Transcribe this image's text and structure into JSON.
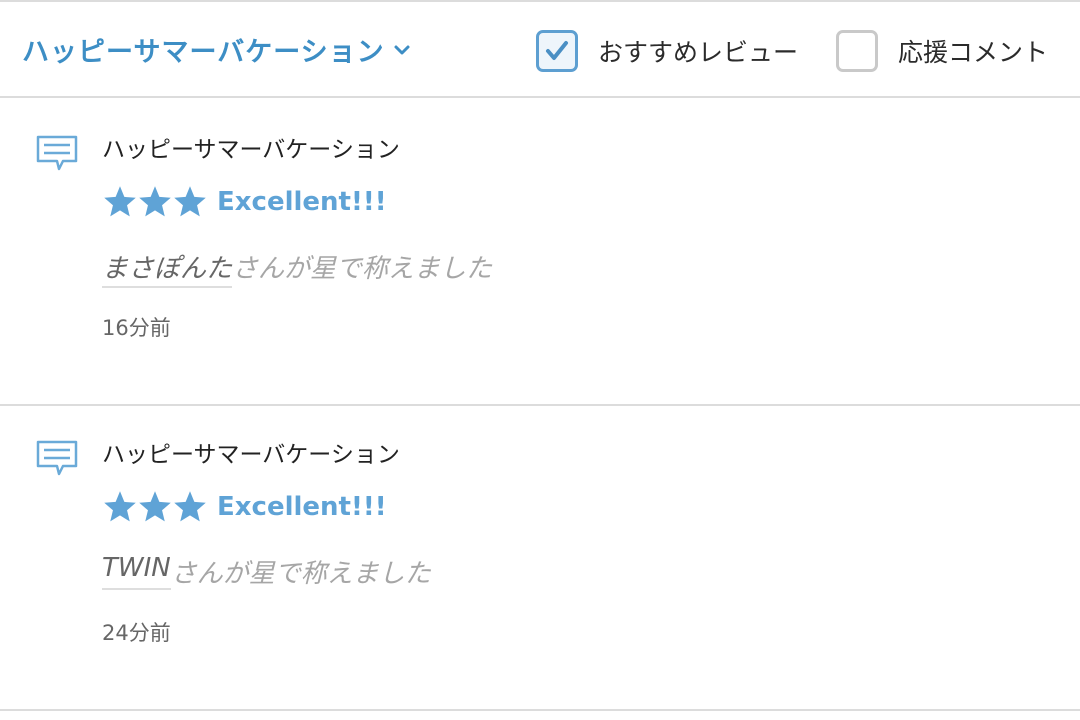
{
  "header": {
    "title": "ハッピーサマーバケーション",
    "filters": [
      {
        "label": "おすすめレビュー",
        "checked": true
      },
      {
        "label": "応援コメント",
        "checked": false
      }
    ]
  },
  "entries": [
    {
      "title": "ハッピーサマーバケーション",
      "stars": 3,
      "rating_label": "Excellent!!!",
      "user": "まさぽんた",
      "praise_suffix": "さんが星で称えました",
      "time": "16分前"
    },
    {
      "title": "ハッピーサマーバケーション",
      "stars": 3,
      "rating_label": "Excellent!!!",
      "user": "TWIN",
      "praise_suffix": "さんが星で称えました",
      "time": "24分前"
    }
  ],
  "colors": {
    "accent": "#3d8ec5",
    "star": "#5fa3d6",
    "divider": "#dcdcdc"
  },
  "icons": {
    "dropdown": "chevron-down-icon",
    "entry": "comment-icon",
    "rating": "star-icon",
    "check": "checkmark-icon"
  }
}
